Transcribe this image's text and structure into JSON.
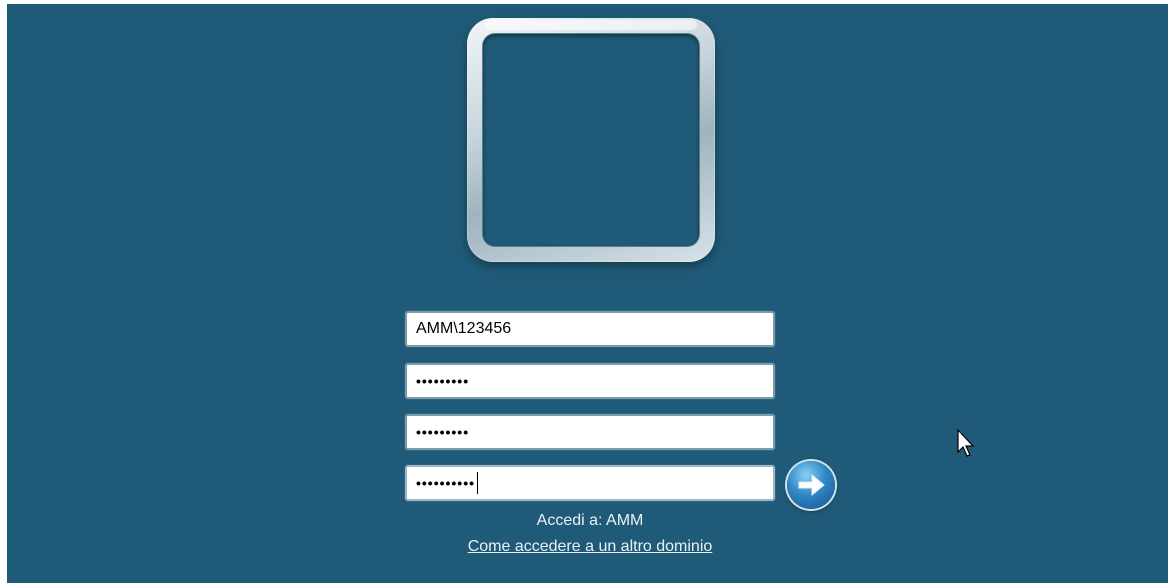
{
  "login": {
    "username": "AMM\\123456",
    "password_1": "•••••••••",
    "password_2": "•••••••••",
    "password_3": "••••••••••",
    "domain_info": "Accedi a: AMM",
    "other_domain_link": "Come accedere a un altro dominio"
  },
  "icons": {
    "avatar": "user-picture-frame",
    "submit": "arrow-right-icon",
    "cursor": "mouse-pointer-icon"
  },
  "colors": {
    "background": "#1f5b78",
    "text": "#e9f1f5",
    "accent": "#2f86c4"
  }
}
